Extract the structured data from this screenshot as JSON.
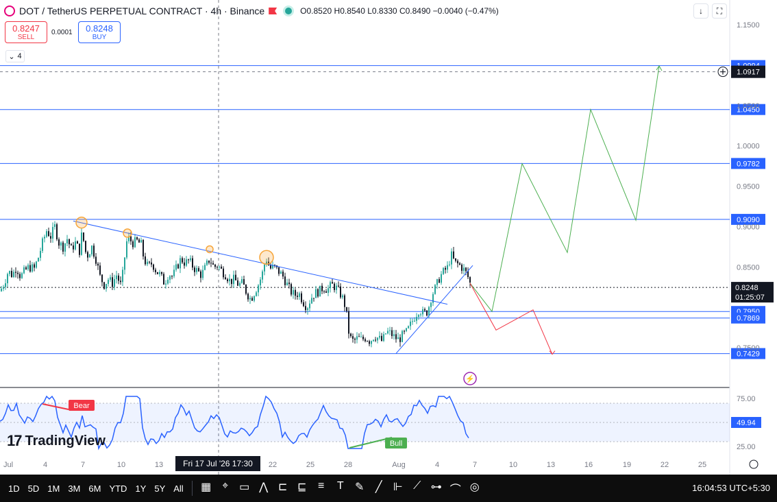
{
  "header": {
    "symbol": "DOT / TetherUS PERPETUAL CONTRACT · 4h · Binance",
    "ohlc": "O0.8520  H0.8540  L0.8330  C0.8490  −0.0040 (−0.47%)"
  },
  "trade": {
    "sell_price": "0.8247",
    "sell_label": "SELL",
    "spread": "0.0001",
    "buy_price": "0.8248",
    "buy_label": "BUY"
  },
  "indicator_count": "4",
  "logo": "TradingView",
  "crosshair_label": "Fri 17 Jul '26   17:30",
  "toolbar": {
    "ranges": [
      "1D",
      "5D",
      "1M",
      "3M",
      "6M",
      "YTD",
      "1Y",
      "5Y",
      "All"
    ],
    "icons": [
      "calendar-icon",
      "crosshair-icon",
      "rectangle-icon",
      "polyline-icon",
      "fib-icon",
      "pattern-icon",
      "channel-icon",
      "text-icon",
      "brush-icon",
      "trendline-icon",
      "ruler-icon",
      "path-icon",
      "anchor-icon",
      "curve-icon",
      "target-icon"
    ],
    "clock": "16:04:53 UTC+5:30"
  },
  "colors": {
    "up": "#26a69a",
    "down": "#131722",
    "blue": "#2962ff",
    "green": "#4caf50",
    "red": "#f23645",
    "orange": "#f7a539",
    "rsi": "#2962ff"
  },
  "chart_data": {
    "type": "candlestick",
    "title": "DOT / TetherUS PERPETUAL CONTRACT · 4h · Binance",
    "y_ticks": [
      "1.1500",
      "1.0500",
      "1.0000",
      "0.9500",
      "0.9000",
      "0.8500",
      "0.7500"
    ],
    "x_ticks": [
      "Jul",
      "4",
      "7",
      "10",
      "13",
      "22",
      "25",
      "28",
      "Aug",
      "4",
      "7",
      "10",
      "13",
      "16",
      "19",
      "22",
      "25"
    ],
    "price_path": [
      [
        0,
        0.82
      ],
      [
        6,
        0.83
      ],
      [
        12,
        0.845
      ],
      [
        18,
        0.84
      ],
      [
        24,
        0.85
      ],
      [
        30,
        0.838
      ],
      [
        36,
        0.845
      ],
      [
        42,
        0.85
      ],
      [
        50,
        0.848
      ],
      [
        56,
        0.862
      ],
      [
        62,
        0.88
      ],
      [
        68,
        0.895
      ],
      [
        74,
        0.888
      ],
      [
        80,
        0.9
      ],
      [
        86,
        0.88
      ],
      [
        92,
        0.875
      ],
      [
        98,
        0.885
      ],
      [
        104,
        0.872
      ],
      [
        110,
        0.88
      ],
      [
        116,
        0.87
      ],
      [
        120,
        0.895
      ],
      [
        124,
        0.87
      ],
      [
        128,
        0.865
      ],
      [
        134,
        0.875
      ],
      [
        140,
        0.86
      ],
      [
        146,
        0.838
      ],
      [
        152,
        0.828
      ],
      [
        158,
        0.835
      ],
      [
        164,
        0.83
      ],
      [
        170,
        0.84
      ],
      [
        176,
        0.828
      ],
      [
        180,
        0.845
      ],
      [
        184,
        0.88
      ],
      [
        188,
        0.885
      ],
      [
        194,
        0.88
      ],
      [
        200,
        0.882
      ],
      [
        206,
        0.878
      ],
      [
        210,
        0.86
      ],
      [
        216,
        0.85
      ],
      [
        222,
        0.855
      ],
      [
        228,
        0.845
      ],
      [
        234,
        0.84
      ],
      [
        240,
        0.83
      ],
      [
        246,
        0.842
      ],
      [
        252,
        0.838
      ],
      [
        258,
        0.85
      ],
      [
        264,
        0.86
      ],
      [
        270,
        0.855
      ],
      [
        276,
        0.858
      ],
      [
        282,
        0.85
      ],
      [
        288,
        0.845
      ],
      [
        294,
        0.84
      ],
      [
        300,
        0.85
      ],
      [
        306,
        0.86
      ],
      [
        312,
        0.85
      ],
      [
        318,
        0.852
      ],
      [
        324,
        0.845
      ],
      [
        330,
        0.84
      ],
      [
        336,
        0.832
      ],
      [
        342,
        0.835
      ],
      [
        348,
        0.828
      ],
      [
        354,
        0.83
      ],
      [
        360,
        0.818
      ],
      [
        366,
        0.81
      ],
      [
        372,
        0.82
      ],
      [
        378,
        0.83
      ],
      [
        384,
        0.845
      ],
      [
        388,
        0.862
      ],
      [
        394,
        0.848
      ],
      [
        400,
        0.85
      ],
      [
        406,
        0.845
      ],
      [
        412,
        0.84
      ],
      [
        418,
        0.83
      ],
      [
        424,
        0.82
      ],
      [
        430,
        0.815
      ],
      [
        436,
        0.818
      ],
      [
        442,
        0.808
      ],
      [
        448,
        0.8
      ],
      [
        454,
        0.812
      ],
      [
        460,
        0.818
      ],
      [
        466,
        0.82
      ],
      [
        472,
        0.825
      ],
      [
        478,
        0.822
      ],
      [
        484,
        0.828
      ],
      [
        490,
        0.825
      ],
      [
        496,
        0.818
      ],
      [
        502,
        0.808
      ],
      [
        506,
        0.79
      ],
      [
        510,
        0.763
      ],
      [
        516,
        0.758
      ],
      [
        522,
        0.762
      ],
      [
        528,
        0.76
      ],
      [
        534,
        0.763
      ],
      [
        540,
        0.758
      ],
      [
        546,
        0.765
      ],
      [
        552,
        0.762
      ],
      [
        558,
        0.758
      ],
      [
        564,
        0.77
      ],
      [
        570,
        0.768
      ],
      [
        576,
        0.763
      ],
      [
        582,
        0.76
      ],
      [
        588,
        0.766
      ],
      [
        594,
        0.77
      ],
      [
        600,
        0.78
      ],
      [
        606,
        0.79
      ],
      [
        612,
        0.798
      ],
      [
        618,
        0.792
      ],
      [
        624,
        0.795
      ],
      [
        630,
        0.815
      ],
      [
        636,
        0.825
      ],
      [
        642,
        0.838
      ],
      [
        648,
        0.845
      ],
      [
        654,
        0.85
      ],
      [
        658,
        0.866
      ],
      [
        664,
        0.855
      ],
      [
        670,
        0.853
      ],
      [
        676,
        0.848
      ],
      [
        682,
        0.84
      ],
      [
        686,
        0.83
      ]
    ],
    "horizontal_levels": [
      {
        "price": 1.0994,
        "label": "1.0994"
      },
      {
        "price": 1.045,
        "label": "1.0450"
      },
      {
        "price": 0.9782,
        "label": "0.9782"
      },
      {
        "price": 0.909,
        "label": "0.9090"
      },
      {
        "price": 0.795,
        "label": "0.7950"
      },
      {
        "price": 0.7869,
        "label": "0.7869"
      },
      {
        "price": 0.7429,
        "label": "0.7429"
      }
    ],
    "current_price": {
      "price": 0.8248,
      "label": "0.8248",
      "countdown": "01:25:07"
    },
    "crosshair_price": {
      "price": 1.0917,
      "label": "1.0917"
    },
    "green_projection": [
      [
        686,
        0.83
      ],
      [
        718,
        0.795
      ],
      [
        762,
        0.978
      ],
      [
        828,
        0.868
      ],
      [
        862,
        1.045
      ],
      [
        928,
        0.908
      ],
      [
        962,
        1.099
      ]
    ],
    "red_projection": [
      [
        686,
        0.83
      ],
      [
        724,
        0.772
      ],
      [
        778,
        0.797
      ],
      [
        806,
        0.742
      ]
    ],
    "rsi": {
      "ticks": [
        "75.00",
        "25.00"
      ],
      "last": "49.94",
      "bear_label": "Bear",
      "bull_label": "Bull"
    }
  }
}
